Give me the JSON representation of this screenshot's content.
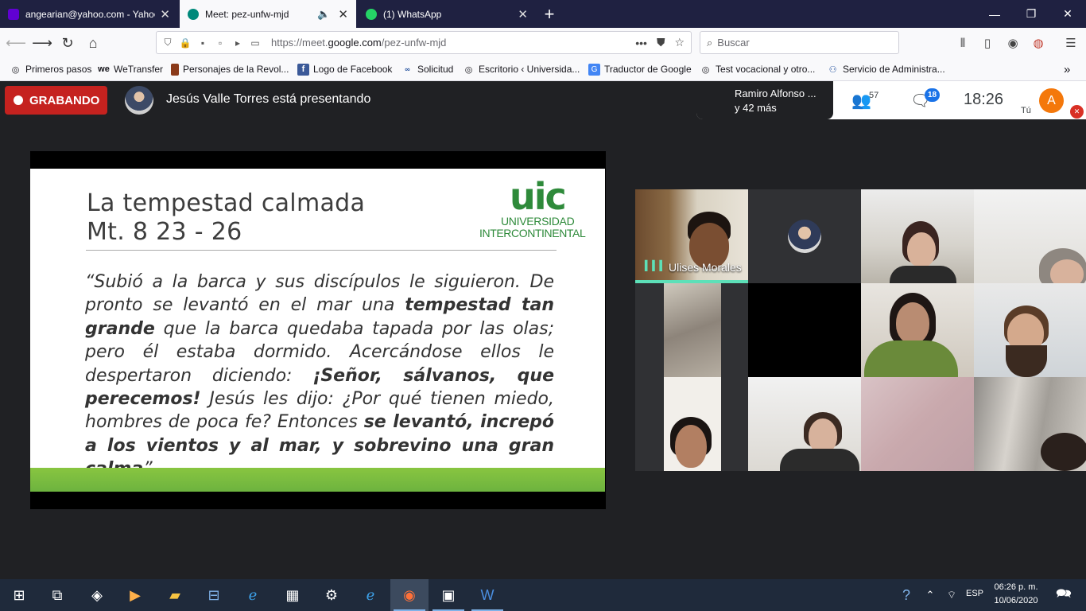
{
  "browser": {
    "tabs": [
      {
        "title": "angearian@yahoo.com - Yahoo",
        "favicon": "yahoo-mail-icon"
      },
      {
        "title": "Meet: pez-unfw-mjd",
        "favicon": "meet-icon",
        "active": true
      },
      {
        "title": "(1) WhatsApp",
        "favicon": "whatsapp-icon"
      }
    ],
    "url": {
      "prefix": "https://meet.",
      "domain": "google.com",
      "path": "/pez-unfw-mjd"
    },
    "search_placeholder": "Buscar",
    "bookmarks": [
      "Primeros pasos",
      "WeTransfer",
      "Personajes de la Revol...",
      "Logo de Facebook",
      "Solicitud",
      "Escritorio ‹ Universida...",
      "Traductor de Google",
      "Test vocacional y otro...",
      "Servicio de Administra..."
    ]
  },
  "meet": {
    "recording_label": "GRABANDO",
    "presenting_text": "Jesús Valle Torres está presentando",
    "others_line1": "Ramiro Alfonso ...",
    "others_line2": "y 42 más",
    "participants_count": "57",
    "chat_count": "18",
    "time": "18:26",
    "self_label": "Tú",
    "self_initial": "A",
    "speaking_name": "Ulises Morales",
    "accent_color": "#5de0b8",
    "record_color": "#c5221f"
  },
  "slide": {
    "title_line1": "La tempestad calmada",
    "title_line2": "Mt. 8 23 - 26",
    "logo_mark": "uic",
    "logo_line1": "UNIVERSIDAD",
    "logo_line2": "INTERCONTINENTAL",
    "body": [
      {
        "text": "“Subió a la barca y sus discípulos le siguieron. De pronto se levantó en el mar una ",
        "bold": false
      },
      {
        "text": "tempestad tan grande",
        "bold": true
      },
      {
        "text": " que la barca quedaba tapada por las olas; pero él estaba dormido. Acercándose ellos le despertaron diciendo: ",
        "bold": false
      },
      {
        "text": "¡Señor, sálvanos, que perecemos!",
        "bold": true
      },
      {
        "text": " Jesús les dijo: ¿Por qué tienen miedo, hombres de poca fe? Entonces ",
        "bold": false
      },
      {
        "text": "se levantó, increpó a los vientos y al mar, y sobrevino una gran calma",
        "bold": true
      },
      {
        "text": "”",
        "bold": false
      }
    ]
  },
  "taskbar": {
    "language": "ESP",
    "time": "06:26 p. m.",
    "date": "10/06/2020"
  }
}
